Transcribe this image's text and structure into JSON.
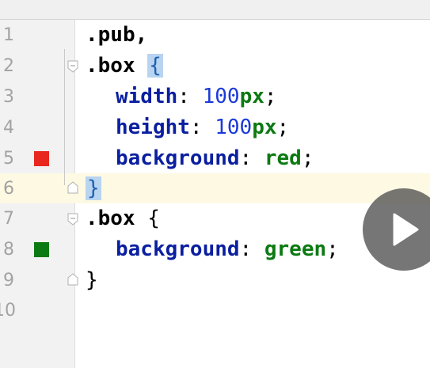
{
  "editor": {
    "current_line": 6,
    "lines": [
      {
        "number": "1",
        "tokens": [
          ".pub,"
        ]
      },
      {
        "number": "2",
        "tokens": [
          ".box",
          "{"
        ]
      },
      {
        "number": "3",
        "tokens": [
          "width",
          ": ",
          "100",
          "px",
          ";"
        ]
      },
      {
        "number": "4",
        "tokens": [
          "height",
          ": ",
          "100",
          "px",
          ";"
        ]
      },
      {
        "number": "5",
        "tokens": [
          "background",
          ": ",
          "red",
          ";"
        ],
        "color_swatch": "#e8281e"
      },
      {
        "number": "6",
        "tokens": [
          "}"
        ]
      },
      {
        "number": "7",
        "tokens": [
          ".box",
          "{"
        ]
      },
      {
        "number": "8",
        "tokens": [
          "background",
          ": ",
          "green",
          ";"
        ],
        "color_swatch": "#0c7a12"
      },
      {
        "number": "9",
        "tokens": [
          "}"
        ]
      },
      {
        "number": "10",
        "tokens": []
      }
    ]
  },
  "overlay": {
    "play_button_icon": "play-icon"
  },
  "colors": {
    "property": "#0a1fa0",
    "number": "#1b3ad8",
    "value": "#0c7a12",
    "current_line_bg": "#fdf9e3",
    "brace_highlight": "#b8d4f0"
  }
}
